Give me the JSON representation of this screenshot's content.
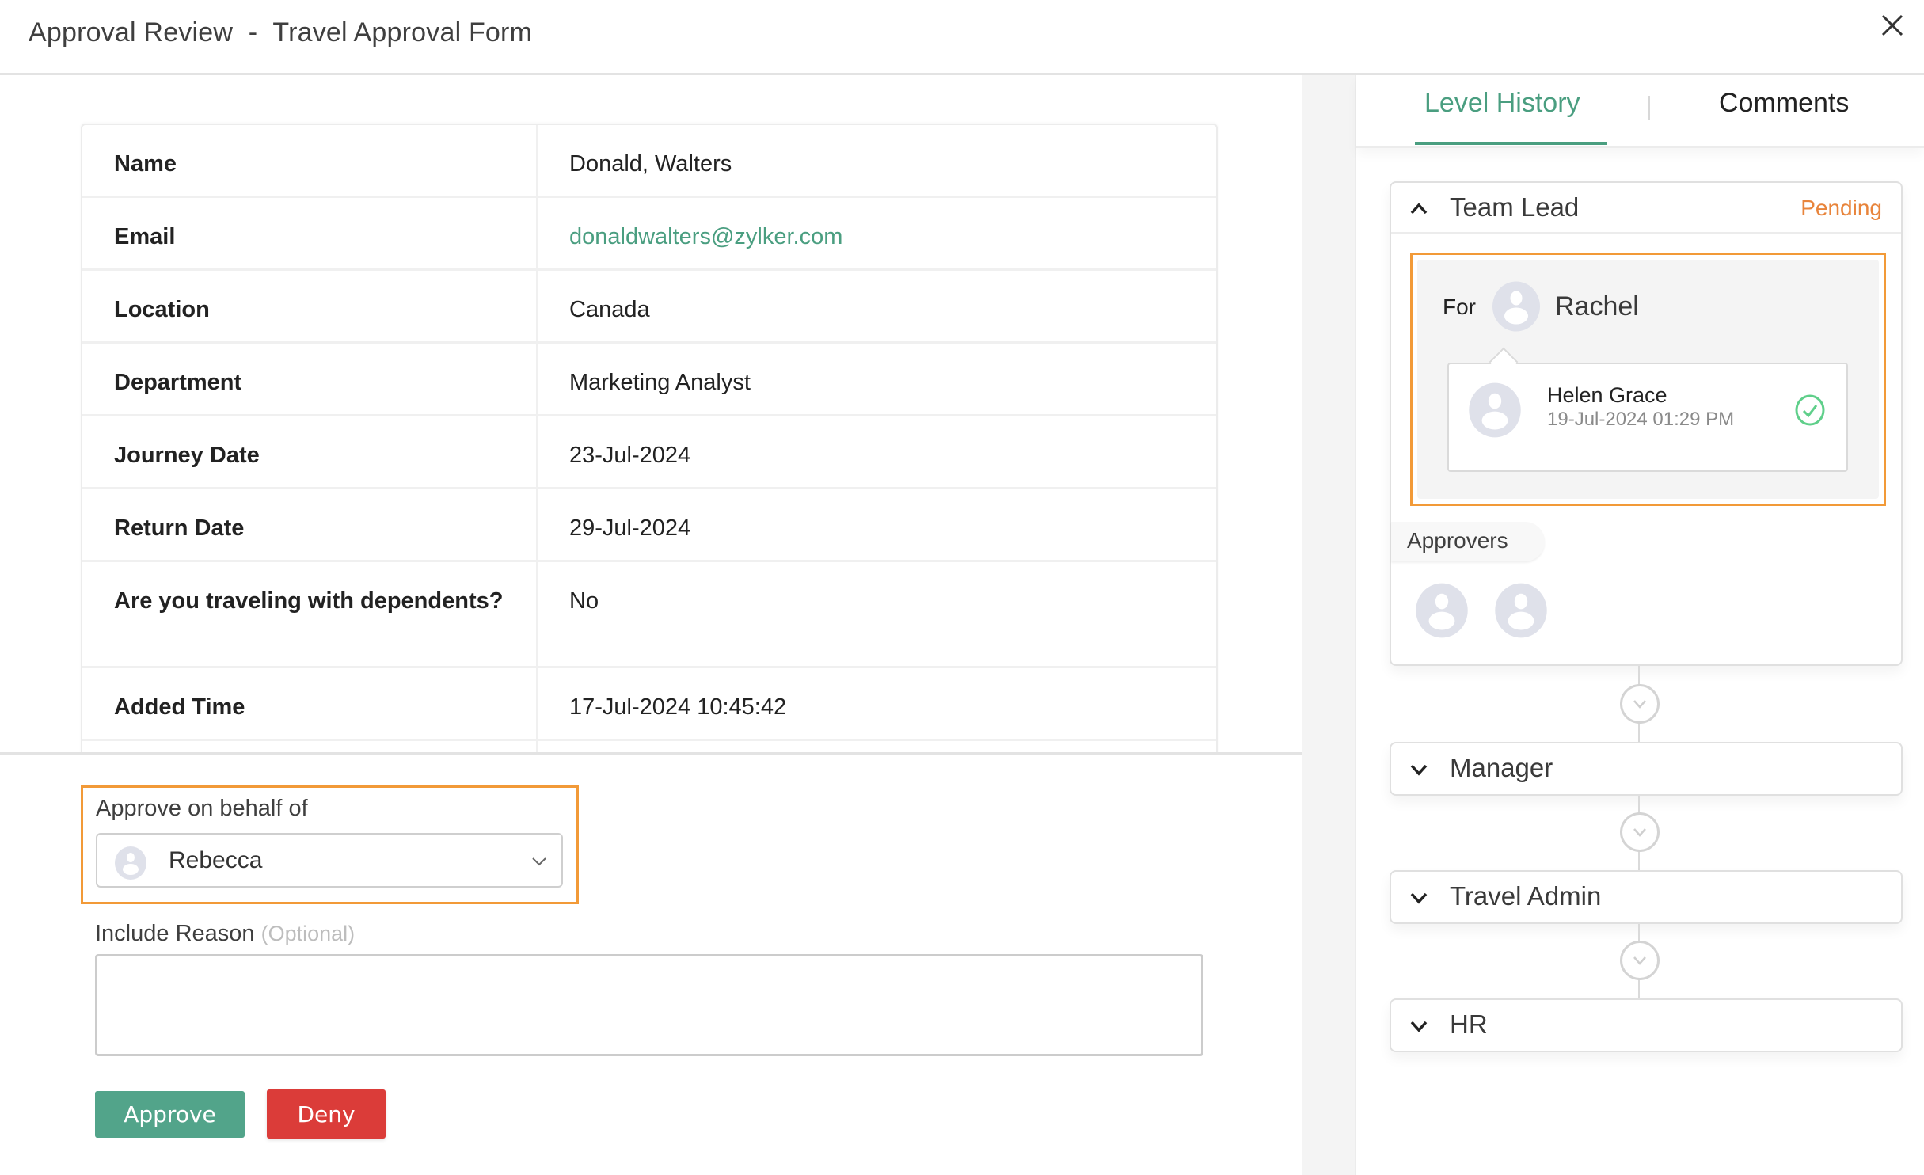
{
  "header": {
    "title_prefix": "Approval Review",
    "title_separator": "-",
    "title_form": "Travel Approval Form",
    "close_icon": "close-icon"
  },
  "record": {
    "fields": [
      {
        "label": "Name",
        "value": "Donald, Walters"
      },
      {
        "label": "Email",
        "value": "donaldwalters@zylker.com"
      },
      {
        "label": "Location",
        "value": "Canada"
      },
      {
        "label": "Department",
        "value": "Marketing Analyst"
      },
      {
        "label": "Journey Date",
        "value": "23-Jul-2024"
      },
      {
        "label": "Return Date",
        "value": "29-Jul-2024"
      },
      {
        "label": "Are you traveling with dependents?",
        "value": "No"
      },
      {
        "label": "Added Time",
        "value": "17-Jul-2024 10:45:42"
      }
    ]
  },
  "action_form": {
    "behalf_label": "Approve on behalf of",
    "behalf_selected": "Rebecca",
    "reason_label": "Include Reason",
    "reason_optional": "(Optional)",
    "reason_value": "",
    "approve_label": "Approve",
    "deny_label": "Deny"
  },
  "side_panel": {
    "tabs": [
      {
        "label": "Level History",
        "active": true
      },
      {
        "label": "Comments",
        "active": false
      }
    ],
    "levels": [
      {
        "name": "Team Lead",
        "status": "Pending",
        "expanded": true,
        "for_label": "For",
        "for_name": "Rachel",
        "delegate": {
          "name": "Helen Grace",
          "time": "19-Jul-2024 01:29 PM",
          "status_icon": "check-circle-icon"
        },
        "approvers_label": "Approvers",
        "approver_count": 2
      },
      {
        "name": "Manager",
        "expanded": false
      },
      {
        "name": "Travel Admin",
        "expanded": false
      },
      {
        "name": "HR",
        "expanded": false
      }
    ]
  },
  "colors": {
    "accent_green": "#4a9e80",
    "approve_button": "#52a48a",
    "deny_button": "#db3c39",
    "pending_orange": "#e8843b",
    "highlight_orange": "#f29a38",
    "check_green": "#5fcf8a"
  }
}
